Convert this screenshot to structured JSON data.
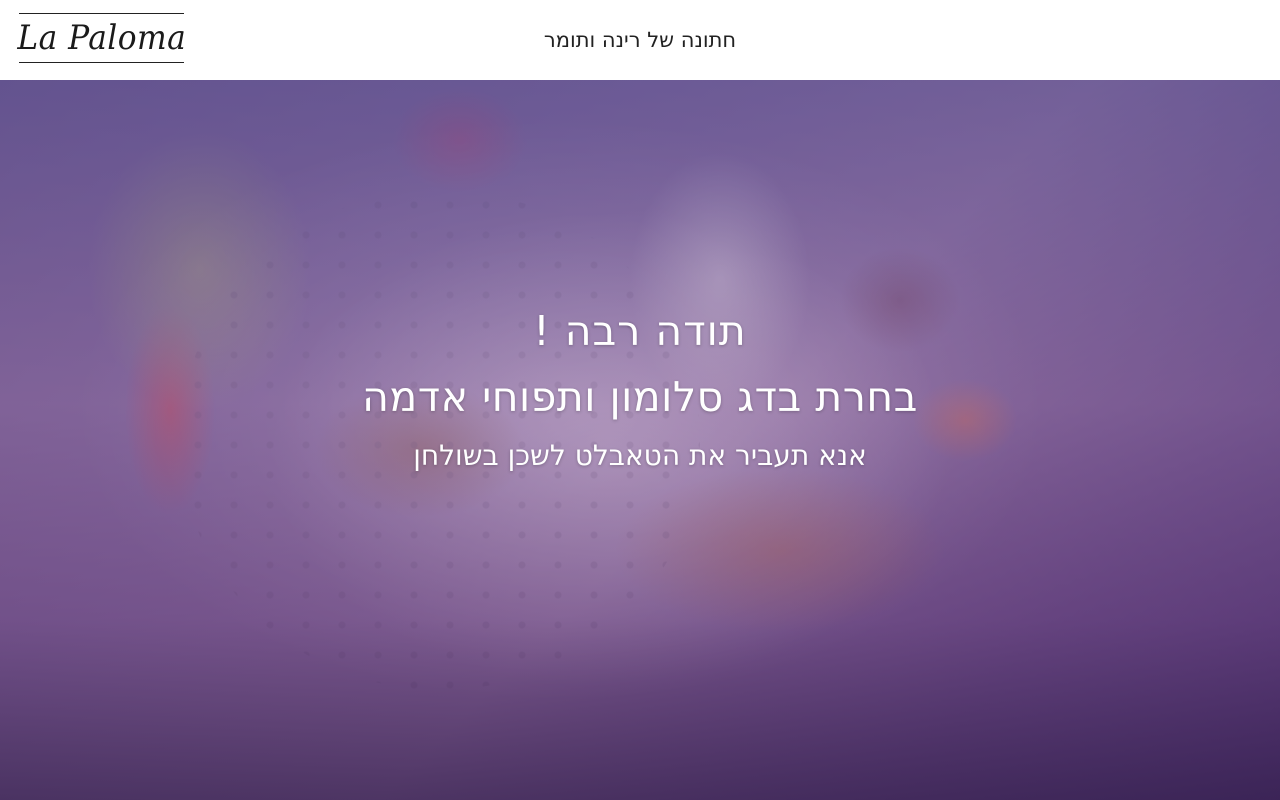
{
  "header": {
    "logo_text": "La Paloma",
    "event_title": "חתונה של רינה ותומר"
  },
  "hero": {
    "thanks": "תודה רבה !",
    "dish_selected": "בחרת בדג סלומון ותפוחי אדמה",
    "instruction": "אנא תעביר את הטאבלט לשכן בשולחן"
  },
  "colors": {
    "header_bg": "#ffffff",
    "overlay_top": "#50408c",
    "overlay_bottom": "#371e50",
    "text": "#ffffff"
  }
}
